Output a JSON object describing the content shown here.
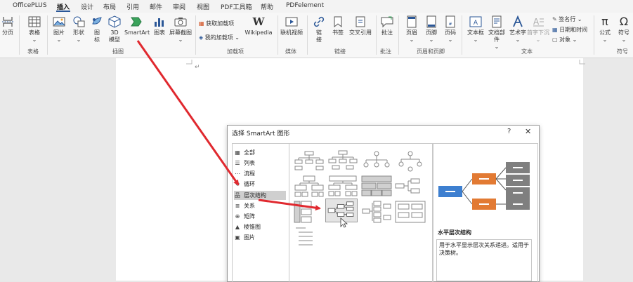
{
  "tabs": [
    "OfficePLUS",
    "插入",
    "设计",
    "布局",
    "引用",
    "邮件",
    "审阅",
    "视图",
    "PDF工具箱",
    "帮助",
    "PDFelement"
  ],
  "active_tab": "插入",
  "ribbon": {
    "buttons": {
      "fenye": "分页",
      "biaoge": "表格",
      "tupian": "图片",
      "xingzhuang": "形状",
      "tubiao_icon": "图标",
      "model3d_line1": "3D",
      "model3d_line2": "模型",
      "smartart": "SmartArt",
      "tubiao_chart": "图表",
      "pingmu": "屏幕截图",
      "wikipedia": "Wikipedia",
      "lianji": "联机视频",
      "lianjie": "链接",
      "shuqian": "书签",
      "jiaocha": "交叉引用",
      "pizhu": "批注",
      "yemei": "页眉",
      "yejiao": "页脚",
      "yema": "页码",
      "wenbenkuang": "文本框",
      "wendang": "文档部件",
      "yishuzi": "艺术字",
      "shouzi": "首字下沉",
      "gongshi": "公式",
      "fuhao": "符号"
    },
    "small": {
      "huoqu": "获取加载项",
      "wode": "我的加载项",
      "qianming": "签名行",
      "riqi": "日期和时间",
      "duixiang": "对象"
    },
    "groups": {
      "biaoge": "表格",
      "chatu": "插图",
      "jiazaixiang": "加载项",
      "meiti": "媒体",
      "lianjie": "链接",
      "pizhu": "批注",
      "yemei": "页眉和页脚",
      "wenben": "文本",
      "fuhao": "符号"
    }
  },
  "document": {
    "paragraph_mark": "↵"
  },
  "dialog": {
    "title": "选择 SmartArt 图形",
    "help": "?",
    "close": "✕",
    "categories": [
      {
        "label": "全部",
        "icon": "▦"
      },
      {
        "label": "列表",
        "icon": "☰"
      },
      {
        "label": "流程",
        "icon": "⋯"
      },
      {
        "label": "循环",
        "icon": "↻"
      },
      {
        "label": "层次结构",
        "icon": "品"
      },
      {
        "label": "关系",
        "icon": "≣"
      },
      {
        "label": "矩阵",
        "icon": "⊕"
      },
      {
        "label": "棱锥图",
        "icon": "▲"
      },
      {
        "label": "图片",
        "icon": "▣"
      }
    ],
    "selected_category": "层次结构",
    "preview": {
      "name": "水平层次结构",
      "description": "用于水平显示层次关系递进。适用于决策树。"
    }
  },
  "colors": {
    "accent": "#2b5797",
    "arrow": "#e0292f",
    "preview_blue": "#3d7fd0",
    "preview_orange": "#e27a33",
    "preview_gray": "#7f7f7f"
  }
}
